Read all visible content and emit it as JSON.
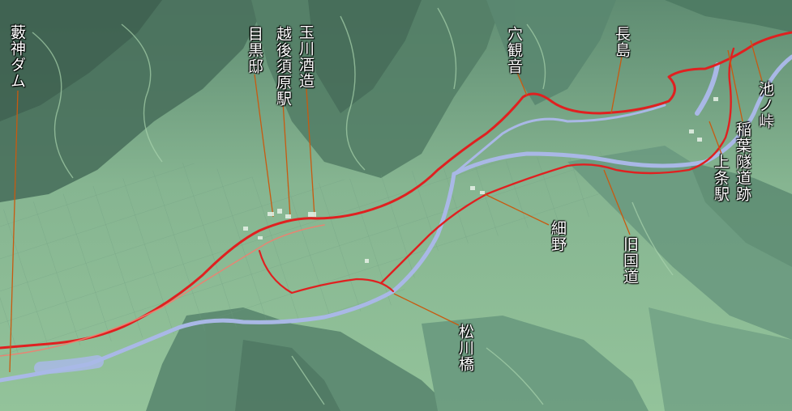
{
  "map": {
    "annotations": [
      {
        "id": "yabukami-dam",
        "text": "藪神ダム"
      },
      {
        "id": "meguro-tei",
        "text": "目黒邸"
      },
      {
        "id": "echigo-suhara-eki",
        "text": "越後須原駅"
      },
      {
        "id": "tamagawa-shuzo",
        "text": "玉川酒造"
      },
      {
        "id": "ana-kannon",
        "text": "穴観音"
      },
      {
        "id": "nagashima",
        "text": "長島"
      },
      {
        "id": "ikenokyo",
        "text": "池ノ峠"
      },
      {
        "id": "inaba-zuido",
        "text": "稲葉隧道跡"
      },
      {
        "id": "kamijo-eki",
        "text": "上条駅"
      },
      {
        "id": "hosono",
        "text": "細野"
      },
      {
        "id": "kyu-kokudo",
        "text": "旧国道"
      },
      {
        "id": "matsukawa-bashi",
        "text": "松川橋"
      }
    ],
    "colors": {
      "route": "#e02020",
      "leader": "#c85a10",
      "label": "#ffffff",
      "water": "#a9b8e6",
      "terrain_low": "#8fbf95",
      "terrain_high": "#3f6a55"
    }
  }
}
